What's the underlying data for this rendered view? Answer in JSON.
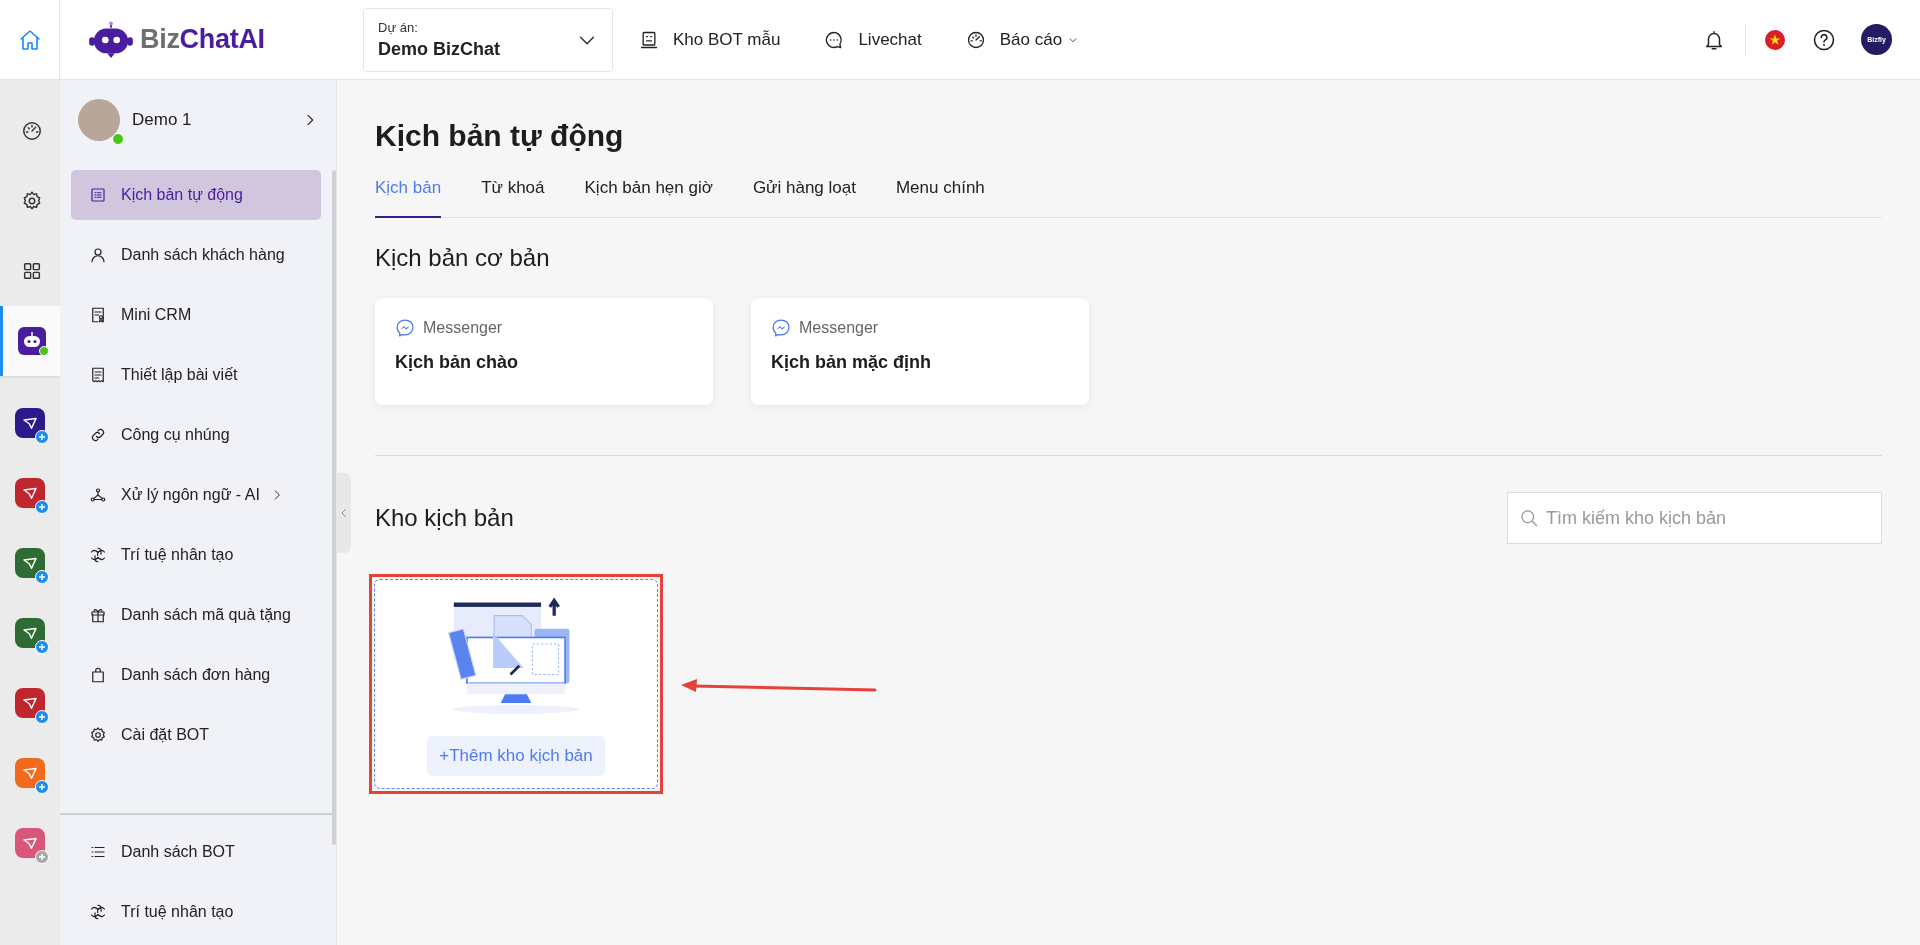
{
  "topbar": {
    "logo": {
      "brand": "Biz",
      "accent": "ChatAI"
    },
    "project": {
      "label": "Dự án:",
      "value": "Demo BizChat"
    },
    "nav": [
      {
        "label": "Kho BOT mẫu",
        "kind": "robot",
        "has_menu": false
      },
      {
        "label": "Livechat",
        "kind": "chat",
        "has_menu": false
      },
      {
        "label": "Báo cáo",
        "kind": "gauge",
        "has_menu": true
      }
    ],
    "account": {
      "avatar_text": "Bizfly"
    }
  },
  "rail": {
    "items": [
      {
        "kind": "gauge",
        "selected": false
      },
      {
        "kind": "gear",
        "selected": false
      },
      {
        "kind": "grid",
        "selected": false
      },
      {
        "kind": "bot",
        "selected": true
      }
    ],
    "apps": [
      {
        "color": "#2a1a8c",
        "enabled": true
      },
      {
        "color": "#c0262d",
        "enabled": true
      },
      {
        "color": "#2f6b35",
        "enabled": true
      },
      {
        "color": "#2f6b35",
        "enabled": true
      },
      {
        "color": "#c0262d",
        "enabled": true
      },
      {
        "color": "#f26a1b",
        "enabled": true
      },
      {
        "color": "#d9567a",
        "enabled": false
      }
    ]
  },
  "sidebar": {
    "profile": {
      "name": "Demo 1",
      "online": true
    },
    "items": [
      {
        "label": "Kịch bản tự động",
        "kind": "list",
        "selected": true,
        "has_submenu": false
      },
      {
        "label": "Danh sách khách hàng",
        "kind": "user",
        "selected": false,
        "has_submenu": false
      },
      {
        "label": "Mini CRM",
        "kind": "receipt",
        "selected": false,
        "has_submenu": false
      },
      {
        "label": "Thiết lập bài viết",
        "kind": "doc",
        "selected": false,
        "has_submenu": false
      },
      {
        "label": "Công cụ nhúng",
        "kind": "link",
        "selected": false,
        "has_submenu": false
      },
      {
        "label": "Xử lý ngôn ngữ - AI",
        "kind": "nodes",
        "selected": false,
        "has_submenu": true
      },
      {
        "label": "Trí tuệ nhân tạo",
        "kind": "ai",
        "selected": false,
        "has_submenu": false
      },
      {
        "label": "Danh sách mã quà tặng",
        "kind": "gift",
        "selected": false,
        "has_submenu": false
      },
      {
        "label": "Danh sách đơn hàng",
        "kind": "bag",
        "selected": false,
        "has_submenu": false
      },
      {
        "label": "Cài đặt BOT",
        "kind": "gear",
        "selected": false,
        "has_submenu": false
      }
    ],
    "bottom_items": [
      {
        "label": "Danh sách BOT",
        "kind": "bullets",
        "selected": false,
        "has_submenu": false
      },
      {
        "label": "Trí tuệ nhân tạo",
        "kind": "ai",
        "selected": false,
        "has_submenu": false
      }
    ]
  },
  "main": {
    "title": "Kịch bản tự động",
    "tabs": [
      {
        "label": "Kịch bản",
        "selected": true
      },
      {
        "label": "Từ khoá",
        "selected": false
      },
      {
        "label": "Kịch bản hẹn giờ",
        "selected": false
      },
      {
        "label": "Gửi hàng loạt",
        "selected": false
      },
      {
        "label": "Menu chính",
        "selected": false
      }
    ],
    "basic_section": {
      "title": "Kịch bản cơ bản",
      "cards": [
        {
          "channel": "Messenger",
          "title": "Kịch bản chào"
        },
        {
          "channel": "Messenger",
          "title": "Kịch bản mặc định"
        }
      ]
    },
    "library_section": {
      "title": "Kho kịch bản",
      "search": {
        "placeholder": "Tìm kiếm kho kịch bản"
      },
      "add_button": "+Thêm kho kịch bản"
    }
  }
}
